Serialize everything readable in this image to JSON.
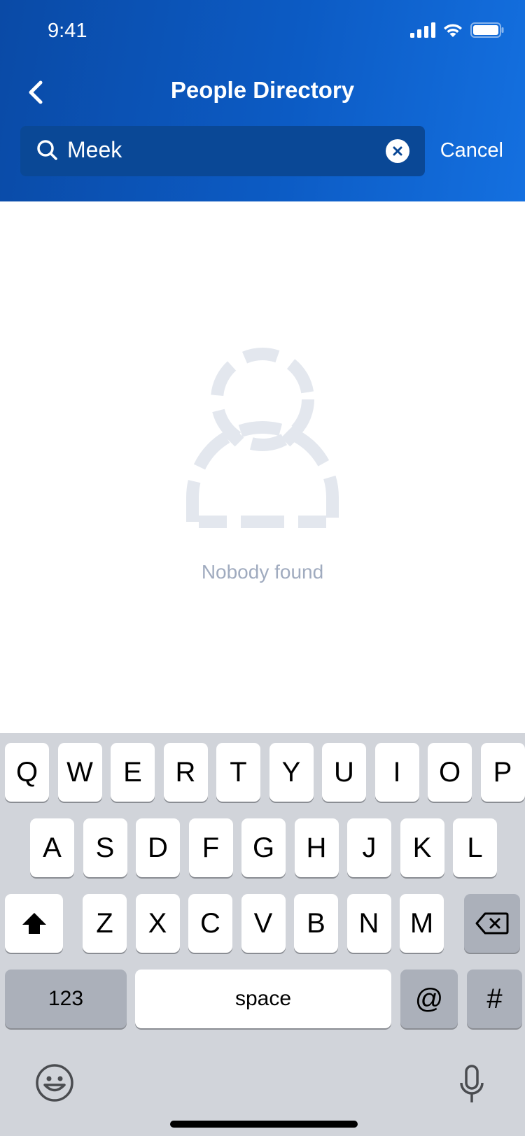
{
  "status_bar": {
    "time": "9:41",
    "icons": [
      "cellular-signal-icon",
      "wifi-icon",
      "battery-icon"
    ]
  },
  "nav": {
    "title": "People Directory",
    "back_icon": "chevron-left-icon"
  },
  "search": {
    "value": "Meek",
    "search_icon": "search-icon",
    "clear_icon": "clear-icon",
    "cancel_label": "Cancel"
  },
  "empty_state": {
    "icon": "person-outline-icon",
    "message": "Nobody found"
  },
  "keyboard": {
    "row1": [
      "Q",
      "W",
      "E",
      "R",
      "T",
      "Y",
      "U",
      "I",
      "O",
      "P"
    ],
    "row2": [
      "A",
      "S",
      "D",
      "F",
      "G",
      "H",
      "J",
      "K",
      "L"
    ],
    "row3": [
      "Z",
      "X",
      "C",
      "V",
      "B",
      "N",
      "M"
    ],
    "shift_icon": "shift-icon",
    "delete_icon": "backspace-icon",
    "numbers_label": "123",
    "space_label": "space",
    "at_label": "@",
    "hash_label": "#",
    "emoji_icon": "emoji-icon",
    "mic_icon": "microphone-icon"
  },
  "colors": {
    "header_start": "#0a4aa6",
    "header_end": "#1470e0",
    "keyboard_bg": "#d1d4da",
    "empty_text": "#a0abbf"
  }
}
